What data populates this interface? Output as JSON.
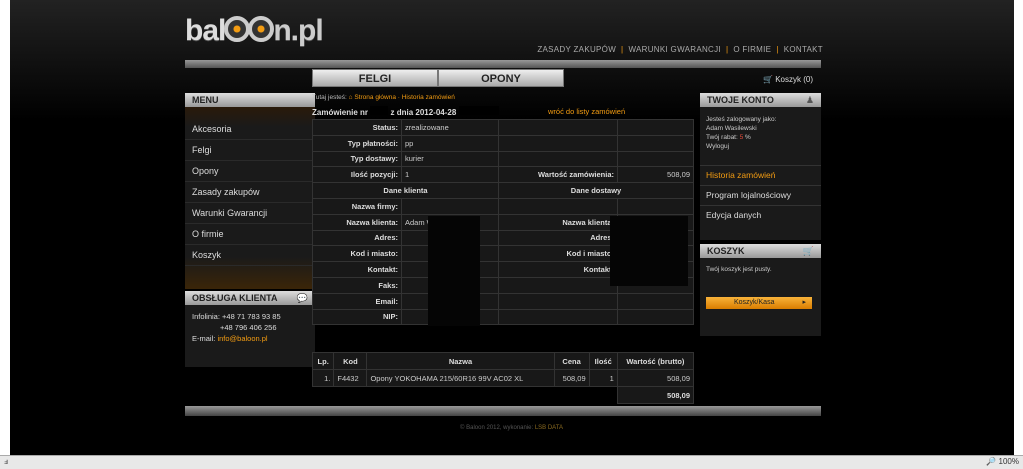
{
  "header": {
    "logo_main": "bal",
    "logo_end": "n.pl",
    "nav": [
      "ZASADY ZAKUPÓW",
      "WARUNKI GWARANCJI",
      "O FIRMIE",
      "KONTAKT"
    ],
    "separator": "|",
    "tabs": [
      "FELGI",
      "OPONY"
    ],
    "cart_label": "Koszyk (0)"
  },
  "menu": {
    "title": "MENU",
    "items": [
      "Akcesoria",
      "Felgi",
      "Opony",
      "Zasady zakupów",
      "Warunki Gwarancji",
      "O firmie",
      "Koszyk"
    ]
  },
  "support": {
    "title": "OBSŁUGA KLIENTA",
    "infolinia_label": "Infolinia:",
    "phone1": "+48 71 783 93 85",
    "phone2": "+48 796 406 256",
    "email_label": "E-mail:",
    "email": "info@baloon.pl"
  },
  "breadcrumb": {
    "prefix": "Tutaj jesteś:",
    "home": "Strona główna",
    "sep": "·",
    "current": "Historia zamówień"
  },
  "order": {
    "title_prefix": "Zamówienie nr",
    "title_date": "z dnia 2012-04-28",
    "back_link": "wróć do listy zamówień",
    "status_label": "Status:",
    "status_value": "zrealizowane",
    "payment_label": "Typ płatności:",
    "payment_value": "pp",
    "delivery_label": "Typ dostawy:",
    "delivery_value": "kurier",
    "items_count_label": "Ilość pozycji:",
    "items_count_value": "1",
    "order_value_label": "Wartość zamówienia:",
    "order_value": "508,09",
    "client_header": "Dane klienta",
    "shipping_header": "Dane dostawy",
    "company_label": "Nazwa firmy:",
    "client_name_label": "Nazwa klienta:",
    "client_name_value": "Adam W",
    "ship_name_label": "Nazwa klienta:",
    "address_label": "Adres:",
    "ship_address_label": "Adres:",
    "zip_label": "Kod i miasto:",
    "ship_zip_label": "Kod i miasto:",
    "contact_label": "Kontakt:",
    "ship_contact_label": "Kontakt:",
    "fax_label": "Faks:",
    "email_label": "Email:",
    "nip_label": "NIP:"
  },
  "products": {
    "columns": [
      "Lp.",
      "Kod",
      "Nazwa",
      "Cena",
      "Ilość",
      "Wartość (brutto)"
    ],
    "rows": [
      {
        "lp": "1.",
        "kod": "F4432",
        "nazwa": "Opony YOKOHAMA 215/60R16 99V AC02 XL",
        "cena": "508,09",
        "ilosc": "1",
        "wartosc": "508,09"
      }
    ],
    "total": "508,09"
  },
  "account": {
    "title": "TWOJE KONTO",
    "logged_as": "Jesteś zalogowany jako:",
    "user": "Adam Wasilewski",
    "discount_label": "Twój rabat:",
    "discount_value": "5",
    "discount_unit": "%",
    "logout": "Wyloguj",
    "links": [
      "Historia zamówień",
      "Program lojalnościowy",
      "Edycja danych"
    ]
  },
  "cart": {
    "title": "KOSZYK",
    "empty_text": "Twój koszyk jest pusty.",
    "button": "Koszyk/Kasa"
  },
  "footer": {
    "copyright": "© Baloon 2012, wykonanie:",
    "maker": "LSB DATA"
  },
  "statusbar": {
    "left": "ⅎ",
    "zoom": "100%"
  },
  "colors": {
    "accent": "#f39c12",
    "background": "#000000"
  }
}
